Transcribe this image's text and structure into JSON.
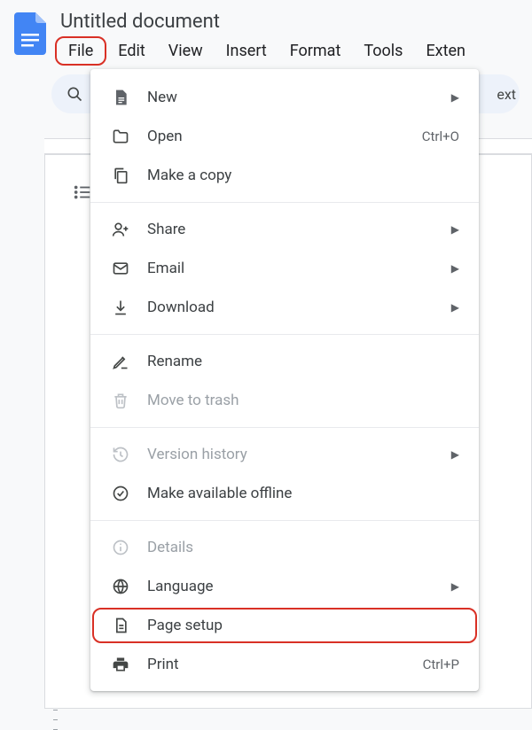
{
  "header": {
    "title": "Untitled document",
    "menus": [
      "File",
      "Edit",
      "View",
      "Insert",
      "Format",
      "Tools",
      "Exten"
    ]
  },
  "toolbar": {
    "right_truncated": "ext"
  },
  "dropdown": {
    "items": [
      {
        "icon": "page-icon",
        "label": "New",
        "arrow": true
      },
      {
        "icon": "folder-icon",
        "label": "Open",
        "shortcut": "Ctrl+O"
      },
      {
        "icon": "copy-icon",
        "label": "Make a copy"
      },
      {
        "sep": true
      },
      {
        "icon": "person-add-icon",
        "label": "Share",
        "arrow": true
      },
      {
        "icon": "email-icon",
        "label": "Email",
        "arrow": true
      },
      {
        "icon": "download-icon",
        "label": "Download",
        "arrow": true
      },
      {
        "sep": true
      },
      {
        "icon": "rename-icon",
        "label": "Rename"
      },
      {
        "icon": "trash-icon",
        "label": "Move to trash",
        "disabled": true
      },
      {
        "sep": true
      },
      {
        "icon": "history-icon",
        "label": "Version history",
        "disabled": true,
        "arrow": true
      },
      {
        "icon": "offline-icon",
        "label": "Make available offline"
      },
      {
        "sep": true
      },
      {
        "icon": "info-icon",
        "label": "Details",
        "disabled": true
      },
      {
        "icon": "globe-icon",
        "label": "Language",
        "arrow": true
      },
      {
        "icon": "page-setup-icon",
        "label": "Page setup",
        "highlight": true
      },
      {
        "icon": "print-icon",
        "label": "Print",
        "shortcut": "Ctrl+P"
      }
    ]
  }
}
